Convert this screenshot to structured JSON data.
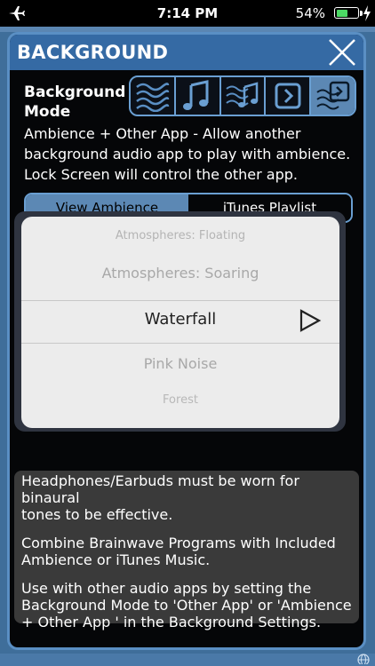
{
  "status_bar": {
    "time": "7:14 PM",
    "battery_percent": "54%",
    "battery_level": 0.54,
    "icons": [
      "airplane-icon",
      "battery-icon",
      "charging-bolt-icon"
    ]
  },
  "colors": {
    "accent": "#5a8fc4",
    "header": "#356aa4",
    "selected": "#5c88b4",
    "panel": "#050608",
    "info_bg": "#3a3a3a"
  },
  "dialog": {
    "title": "BACKGROUND",
    "close_icon": "close-x-icon"
  },
  "background_mode": {
    "label_line1": "Background",
    "label_line2": "Mode",
    "options": [
      {
        "icon": "ambience-waves-icon",
        "selected": false
      },
      {
        "icon": "music-note-icon",
        "selected": false
      },
      {
        "icon": "waves-and-music-icon",
        "selected": false
      },
      {
        "icon": "other-app-icon",
        "selected": false
      },
      {
        "icon": "ambience-plus-other-app-icon",
        "selected": true
      }
    ],
    "description_line1": "Ambience + Other App - Allow another",
    "description_line2": "background audio app to play with ambience.",
    "description_line3": "Lock Screen will control the other app."
  },
  "source_tabs": {
    "view_ambience": "View Ambience",
    "itunes_playlist": "iTunes Playlist",
    "selected": "View Ambience"
  },
  "picker": {
    "items": {
      "far_top": "Atmospheres: Floating",
      "near_top": "Atmospheres: Soaring",
      "selected": "Waterfall",
      "near_bottom": "Pink Noise",
      "far_bottom": "Forest"
    },
    "play_icon": "play-triangle-icon"
  },
  "info": {
    "p1_line1": "Headphones/Earbuds must be worn for binaural",
    "p1_line2": "tones to be effective.",
    "p2_line1": "Combine Brainwave Programs with Included",
    "p2_line2": "Ambience or iTunes Music.",
    "p3_line1": "Use with other audio apps by setting the",
    "p3_line2": "Background Mode to 'Other App' or 'Ambience",
    "p3_line3": "+ Other App ' in the Background Settings."
  }
}
